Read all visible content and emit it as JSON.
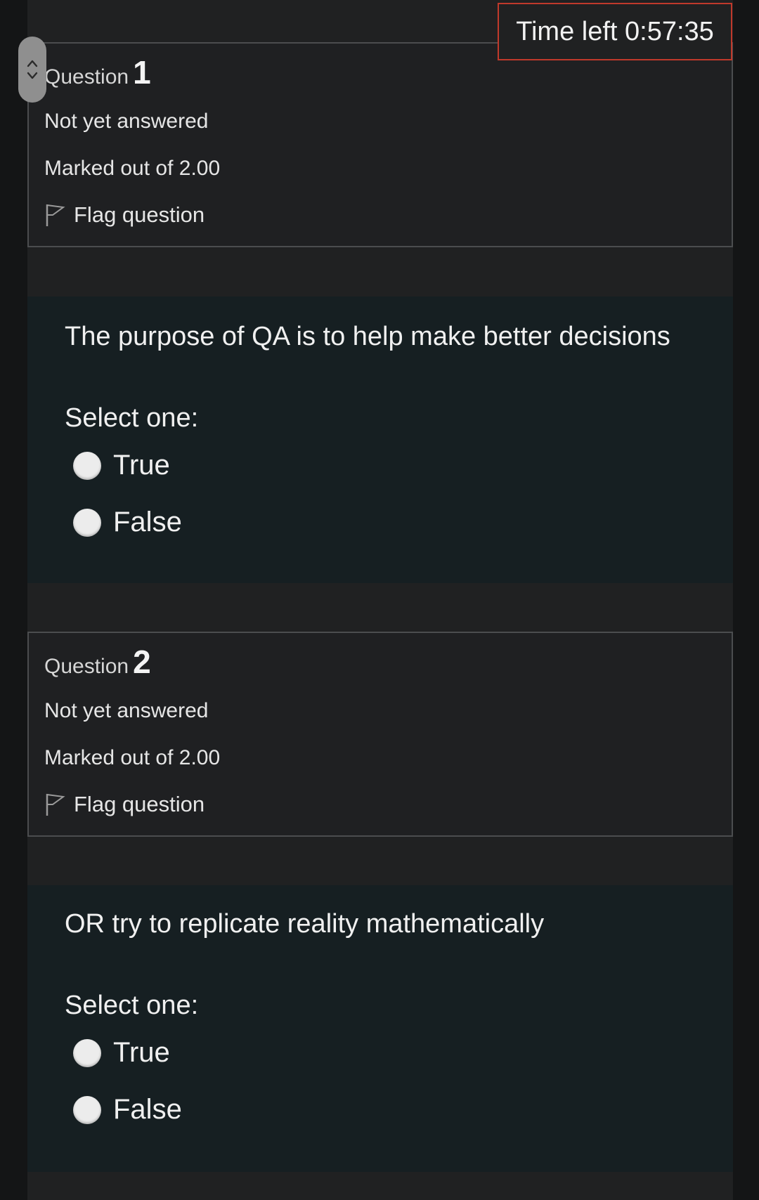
{
  "timer": {
    "label": "Time left 0:57:35"
  },
  "questions": [
    {
      "label": "Question",
      "number": "1",
      "status": "Not yet answered",
      "marks": "Marked out of 2.00",
      "flag_label": "Flag question",
      "text": "The purpose of QA is to help make better decisions",
      "prompt": "Select one:",
      "options": [
        "True",
        "False"
      ]
    },
    {
      "label": "Question",
      "number": "2",
      "status": "Not yet answered",
      "marks": "Marked out of 2.00",
      "flag_label": "Flag question",
      "text": "OR try to replicate reality mathematically",
      "prompt": "Select one:",
      "options": [
        "True",
        "False"
      ]
    }
  ],
  "icons": {
    "flag": "flag-icon",
    "scroll_up": "chevron-up-icon",
    "scroll_down": "chevron-down-icon"
  },
  "colors": {
    "timer_border": "#c0392b",
    "panel_bg": "#161f22",
    "info_bg": "#1f2022"
  }
}
